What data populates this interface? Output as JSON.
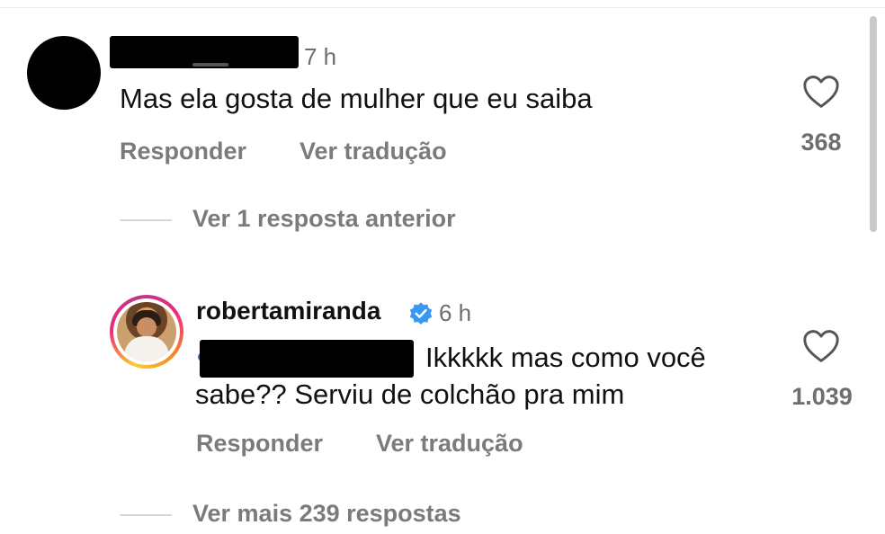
{
  "first_comment": {
    "time": "7 h",
    "text": "Mas ela gosta de mulher que eu saiba",
    "reply_label": "Responder",
    "translate_label": "Ver tradução",
    "like_count": "368"
  },
  "view_previous_replies": "Ver 1 resposta anterior",
  "reply_comment": {
    "username": "robertamiranda",
    "time": "6 h",
    "text_line1": "Ikkkkk mas como você",
    "text_line2": "sabe?? Serviu de colchão pra mim",
    "reply_label": "Responder",
    "translate_label": "Ver tradução",
    "like_count": "1.039"
  },
  "view_more_replies": "Ver mais 239 respostas",
  "icons": {
    "like": "heart-outline-icon",
    "verified": "verified-badge-icon"
  },
  "colors": {
    "verified_blue": "#3897f0",
    "secondary_text": "#7b7b7b"
  }
}
